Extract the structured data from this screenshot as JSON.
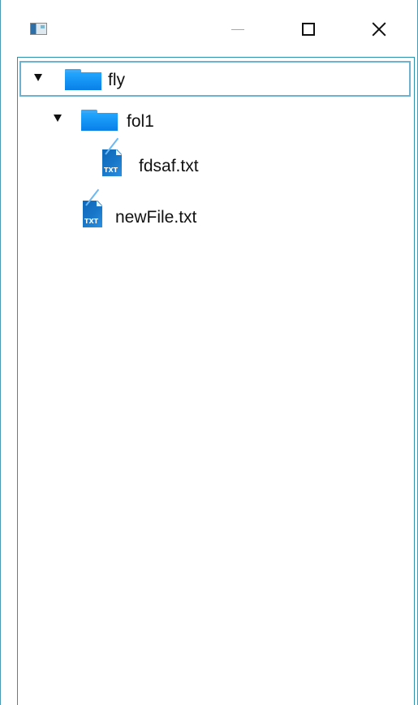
{
  "titlebar": {
    "app_icon": "window-app-icon",
    "minimize_icon": "minimize-icon",
    "maximize_icon": "maximize-icon",
    "close_icon": "close-icon"
  },
  "tree": {
    "items": [
      {
        "label": "fly",
        "type": "folder",
        "expanded": true,
        "selected": true,
        "icon": "folder-icon"
      },
      {
        "label": "fol1",
        "type": "folder",
        "expanded": true,
        "selected": false,
        "icon": "folder-icon"
      },
      {
        "label": "fdsaf.txt",
        "type": "file",
        "selected": false,
        "icon": "text-file-icon",
        "badge": "TXT"
      },
      {
        "label": "newFile.txt",
        "type": "file",
        "selected": false,
        "icon": "text-file-icon",
        "badge": "TXT"
      }
    ]
  },
  "colors": {
    "window_border": "#4a9ab5",
    "tree_border": "#2d91ad",
    "selection_border": "#6fb2cf",
    "folder_blue": "#1695f5",
    "file_blue": "#1877c9"
  }
}
